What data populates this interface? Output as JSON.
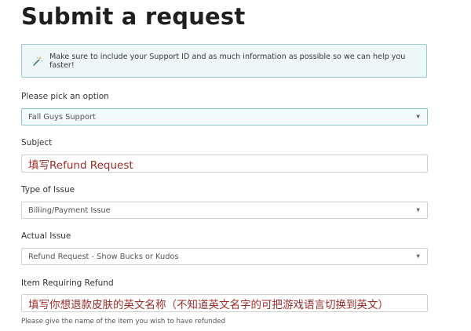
{
  "page_title": "Submit a request",
  "notice": {
    "text": "Make sure to include your Support ID and as much information as possible so we can help you faster!",
    "icon": "magic-wand-icon"
  },
  "fields": {
    "option": {
      "label": "Please pick an option",
      "value": "Fall Guys Support"
    },
    "subject": {
      "label": "Subject",
      "value": "填写Refund Request"
    },
    "type_of_issue": {
      "label": "Type of Issue",
      "value": "Billing/Payment Issue"
    },
    "actual_issue": {
      "label": "Actual Issue",
      "value": "Refund Request - Show Bucks or Kudos"
    },
    "item_refund": {
      "label": "Item Requiring Refund",
      "value": "填写你想退款皮肤的英文名称（不知道英文名字的可把游戏语言切换到英文）",
      "hint": "Please give the name of the item you wish to have refunded"
    }
  },
  "caret_glyph": "▼",
  "colors": {
    "accent": "#8ec3c9",
    "typed_text": "#9a2d2a"
  }
}
